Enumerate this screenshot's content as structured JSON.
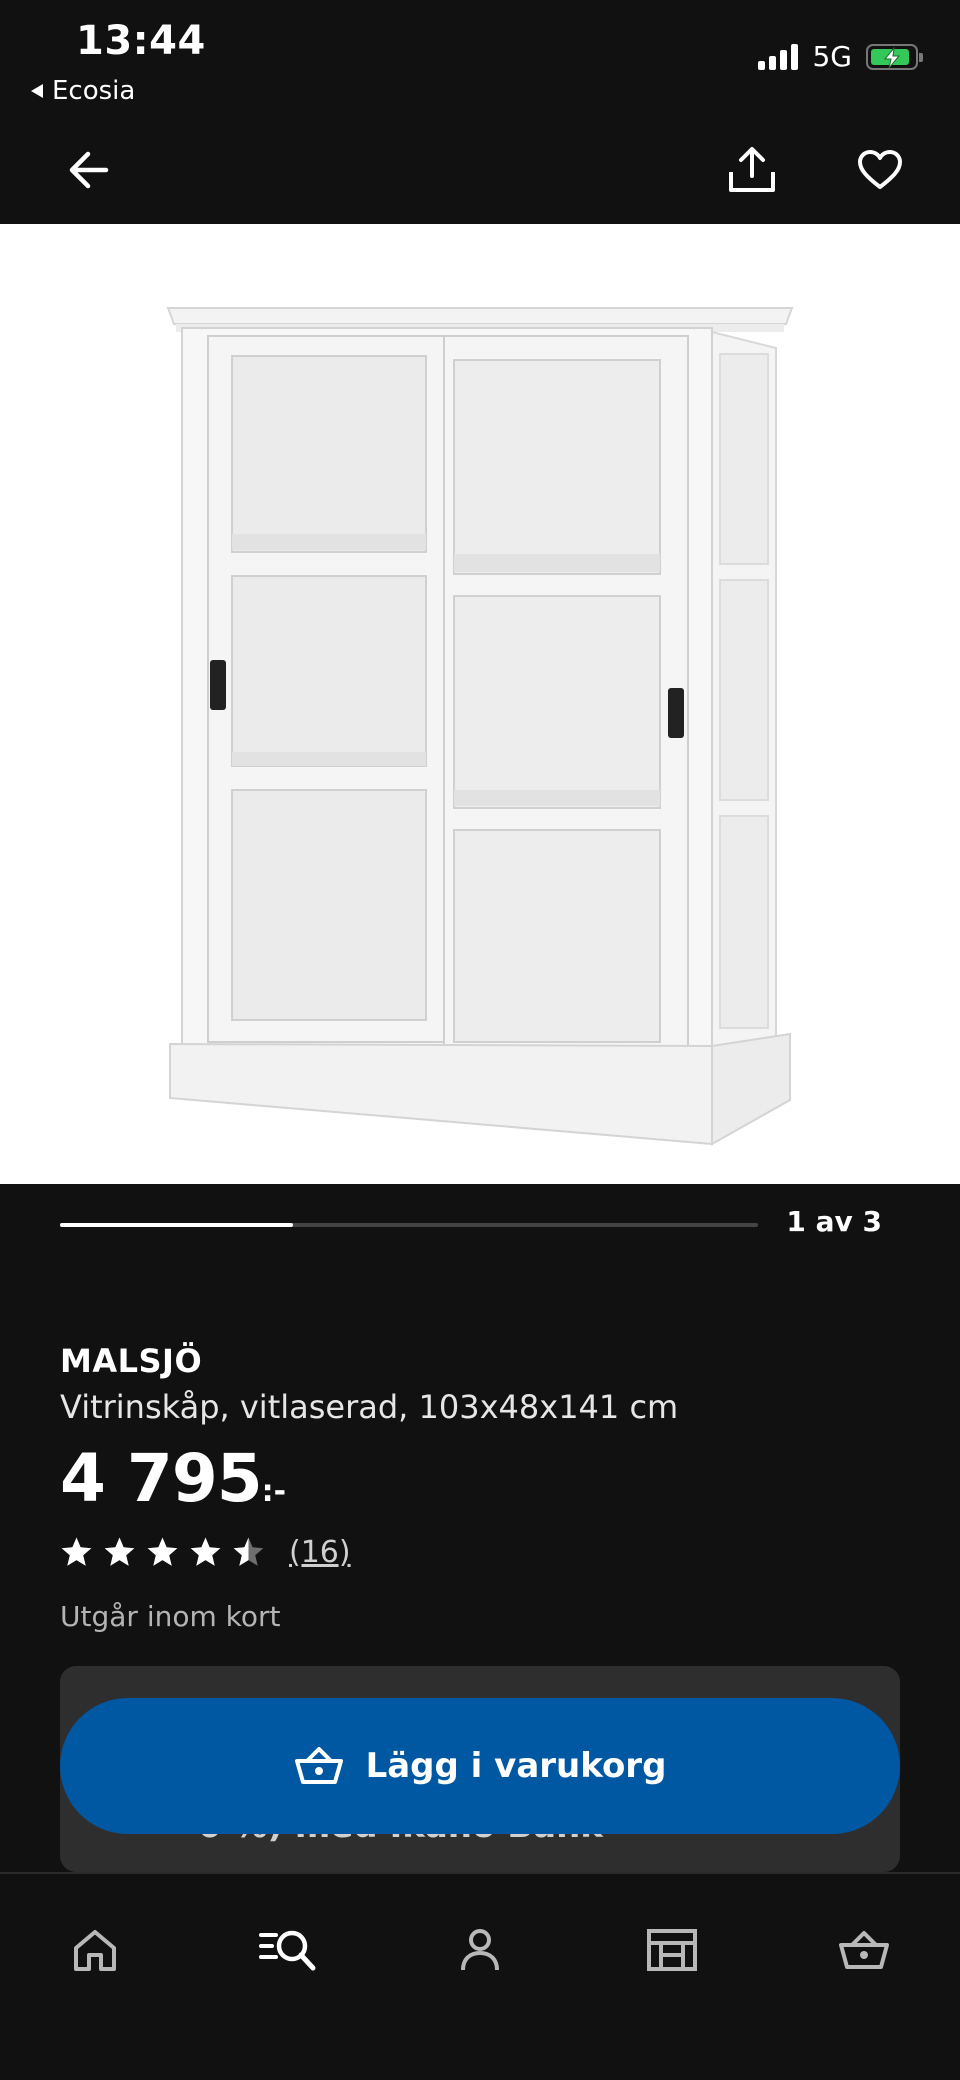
{
  "status_bar": {
    "time": "13:44",
    "back_app": "Ecosia",
    "network": "5G"
  },
  "nav": {
    "back_icon": "arrow-left-icon",
    "share_icon": "share-icon",
    "favorite_icon": "heart-icon"
  },
  "carousel": {
    "counter": "1 av 3",
    "current": 1,
    "total": 3
  },
  "product": {
    "name": "MALSJÖ",
    "description": "Vitrinskåp, vitlaserad, 103x48x141 cm",
    "price_value": "4 795",
    "price_suffix": ":-",
    "rating_value": 4.5,
    "rating_max": 5,
    "rating_count": "(16)",
    "availability": "Utgår inom kort"
  },
  "offer": {
    "text": "0 %) med Ikano Bank"
  },
  "cta": {
    "add_to_cart_label": "Lägg i varukorg",
    "icon": "basket-icon"
  },
  "tab_bar": {
    "items": [
      {
        "name": "home",
        "icon": "home-icon"
      },
      {
        "name": "search",
        "icon": "search-list-icon"
      },
      {
        "name": "profile",
        "icon": "user-icon"
      },
      {
        "name": "store",
        "icon": "store-icon"
      },
      {
        "name": "cart",
        "icon": "basket-icon"
      }
    ]
  },
  "colors": {
    "background": "#111111",
    "primary_button": "#0058a3",
    "battery": "#34c759"
  }
}
